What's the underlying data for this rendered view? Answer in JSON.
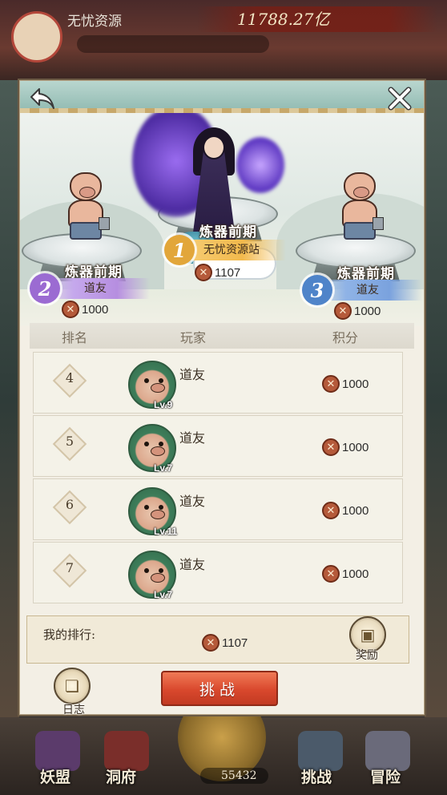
{
  "background": {
    "player_name": "无忧资源",
    "power_value": "11788.27亿",
    "nav": {
      "alliance": "妖盟",
      "cave": "洞府",
      "battle": "挑战",
      "adventure": "冒险",
      "stone_count": "55432"
    }
  },
  "dialog": {
    "back_icon": "back-arrow-icon",
    "close_icon": "close-icon",
    "podium": {
      "first": {
        "rank": "1",
        "realm": "炼器前期",
        "name": "无忧资源站",
        "score": "1107"
      },
      "second": {
        "rank": "2",
        "realm": "炼器前期",
        "name": "道友",
        "score": "1000"
      },
      "third": {
        "rank": "3",
        "realm": "炼器前期",
        "name": "道友",
        "score": "1000"
      }
    },
    "columns": {
      "rank": "排名",
      "player": "玩家",
      "score": "积分"
    },
    "rows": [
      {
        "rank": "4",
        "name": "道友",
        "level": "Lv.9",
        "score": "1000"
      },
      {
        "rank": "5",
        "name": "道友",
        "level": "Lv.7",
        "score": "1000"
      },
      {
        "rank": "6",
        "name": "道友",
        "level": "Lv.11",
        "score": "1000"
      },
      {
        "rank": "7",
        "name": "道友",
        "level": "Lv.7",
        "score": "1000"
      }
    ],
    "my_rank": {
      "label": "我的排行:",
      "score": "1107"
    },
    "reward_label": "奖励",
    "log_label": "日志",
    "challenge_label": "挑战"
  },
  "colors": {
    "challenge_button": "#d9482d",
    "rank1_medal": "#e2a63a",
    "rank2_medal": "#9b6bd2",
    "rank3_medal": "#4f84c9",
    "avatar_ring": "#3e7d5a"
  }
}
